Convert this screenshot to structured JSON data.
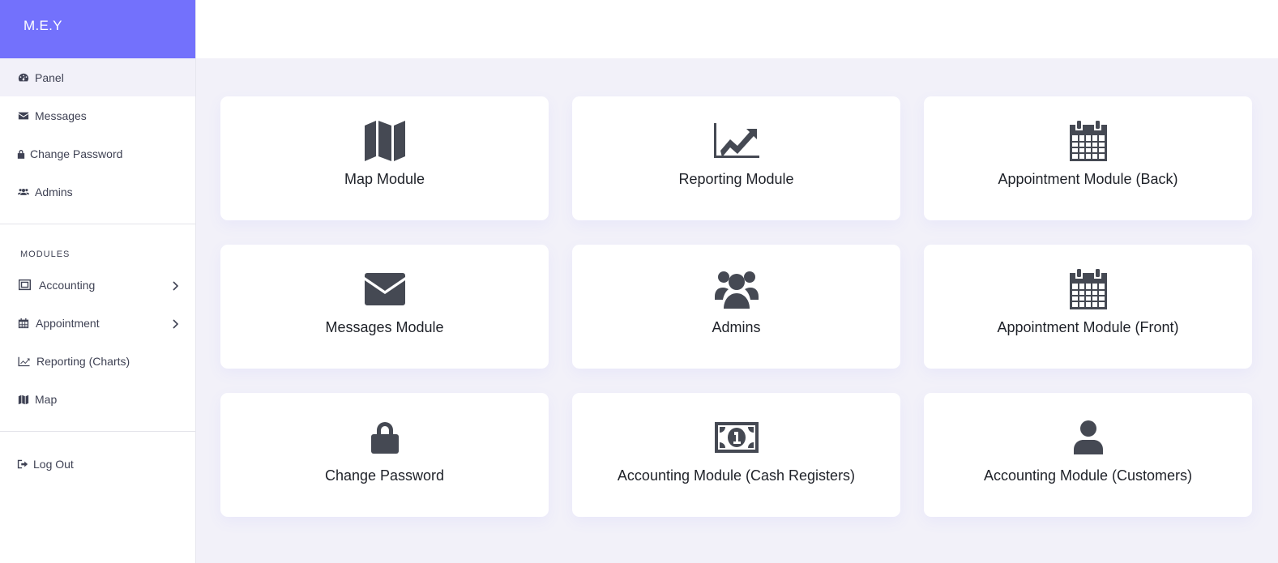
{
  "brand": "M.E.Y",
  "nav_main": [
    {
      "label": "Panel",
      "icon": "gauge-icon"
    },
    {
      "label": "Messages",
      "icon": "envelope-icon"
    },
    {
      "label": "Change Password",
      "icon": "lock-icon"
    },
    {
      "label": "Admins",
      "icon": "users-icon"
    }
  ],
  "modules_title": "MODULES",
  "nav_modules": [
    {
      "label": "Accounting",
      "icon": "cash-register-icon"
    },
    {
      "label": "Appointment",
      "icon": "calendar-icon"
    },
    {
      "label": "Reporting (Charts)",
      "icon": "chart-line-icon"
    },
    {
      "label": "Map",
      "icon": "map-icon"
    }
  ],
  "logout": {
    "label": "Log Out",
    "icon": "sign-out-icon"
  },
  "cards": [
    {
      "label": "Map Module",
      "icon": "map-icon"
    },
    {
      "label": "Reporting Module",
      "icon": "chart-line-icon"
    },
    {
      "label": "Appointment Module (Back)",
      "icon": "calendar-icon"
    },
    {
      "label": "Messages Module",
      "icon": "envelope-icon"
    },
    {
      "label": "Admins",
      "icon": "users-icon"
    },
    {
      "label": "Appointment Module (Front)",
      "icon": "calendar-icon"
    },
    {
      "label": "Change Password",
      "icon": "lock-icon"
    },
    {
      "label": "Accounting Module (Cash Registers)",
      "icon": "money-bill-icon"
    },
    {
      "label": "Accounting Module (Customers)",
      "icon": "user-icon"
    }
  ],
  "colors": {
    "brand": "#7371fc",
    "icon": "#454953",
    "background": "#f2f1f9"
  }
}
